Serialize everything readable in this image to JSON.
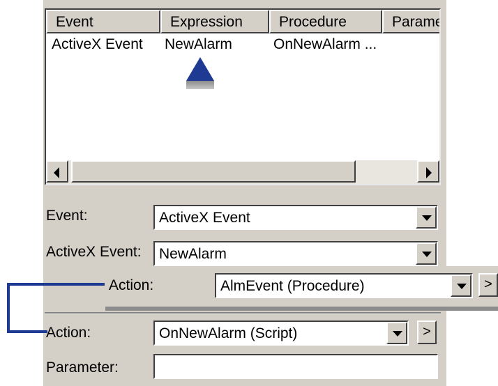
{
  "list": {
    "columns": [
      "Event",
      "Expression",
      "Procedure",
      "Parame"
    ],
    "rows": [
      {
        "event": "ActiveX Event",
        "expression": "NewAlarm",
        "procedure": "OnNewAlarm ..."
      }
    ]
  },
  "form": {
    "event_label": "Event:",
    "event_value": "ActiveX Event",
    "activex_label": "ActiveX Event:",
    "activex_value": "NewAlarm",
    "action_label": "Action:",
    "action_value": "OnNewAlarm (Script)",
    "parameter_label": "Parameter:",
    "parameter_value": "",
    "more_label": ">"
  },
  "callout": {
    "action_label": "Action:",
    "action_value": "AlmEvent (Procedure)",
    "more_label": ">"
  },
  "colors": {
    "accent": "#1f3a93",
    "panel": "#d4d0c8"
  }
}
